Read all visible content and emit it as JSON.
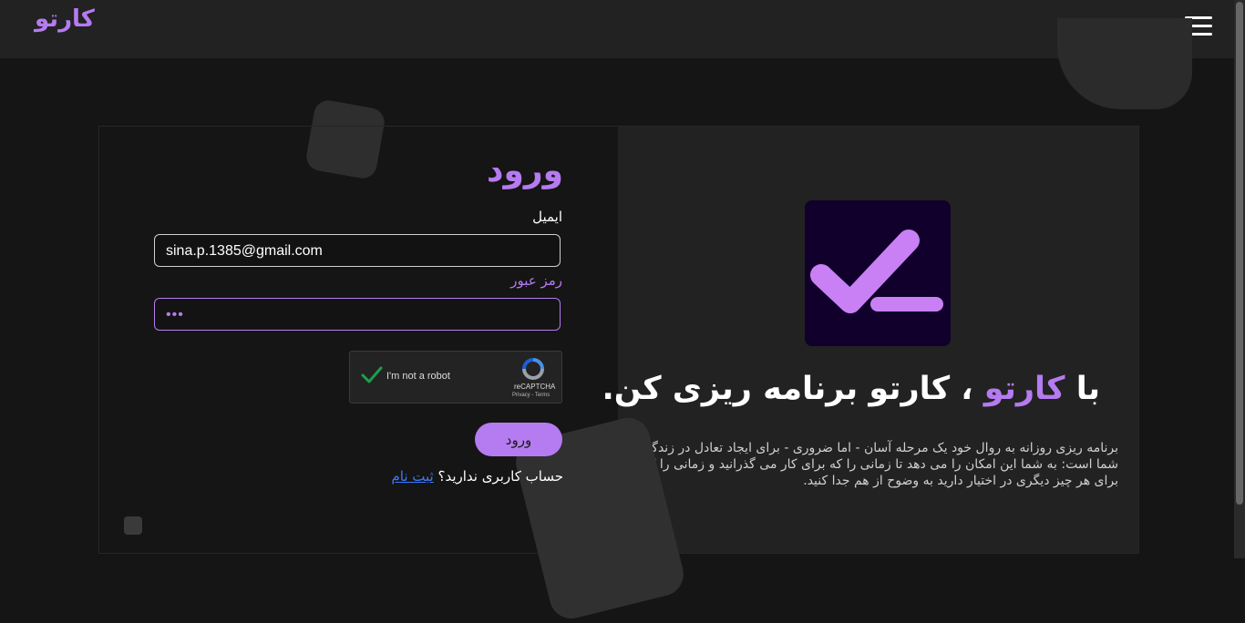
{
  "header": {
    "brand": "کارتو",
    "menu_icon": "hamburger-icon"
  },
  "login": {
    "title": "ورود",
    "email_label": "ایمیل",
    "email_value": "sina.p.1385@gmail.com",
    "password_label": "رمز عبور",
    "password_masked": "•••",
    "recaptcha": {
      "checkbox_text": "I'm not a robot",
      "brand": "reCAPTCHA",
      "terms": "Privacy - Terms"
    },
    "submit_label": "ورود",
    "no_account_text": "حساب کاربری ندارید؟",
    "signup_link": "ثبت نام"
  },
  "hero": {
    "logo_icon": "checkmark-logo-icon",
    "headline_prefix": "با",
    "headline_brand": "کارتو",
    "headline_suffix": "، کارتو برنامه ریزی کن.",
    "description": "برنامه ریزی روزانه به روال خود یک مرحله آسان - اما ضروری - برای ایجاد تعادل در زندگی شما است: به شما این امکان را می دهد تا زمانی را که برای کار می گذرانید و زمانی را که برای هر چیز دیگری در اختیار دارید به وضوح از هم جدا کنید."
  },
  "colors": {
    "accent": "#b57bf0",
    "background": "#151515",
    "topbar": "#222222",
    "link": "#3b7bff",
    "logo_bg": "#10002b"
  }
}
